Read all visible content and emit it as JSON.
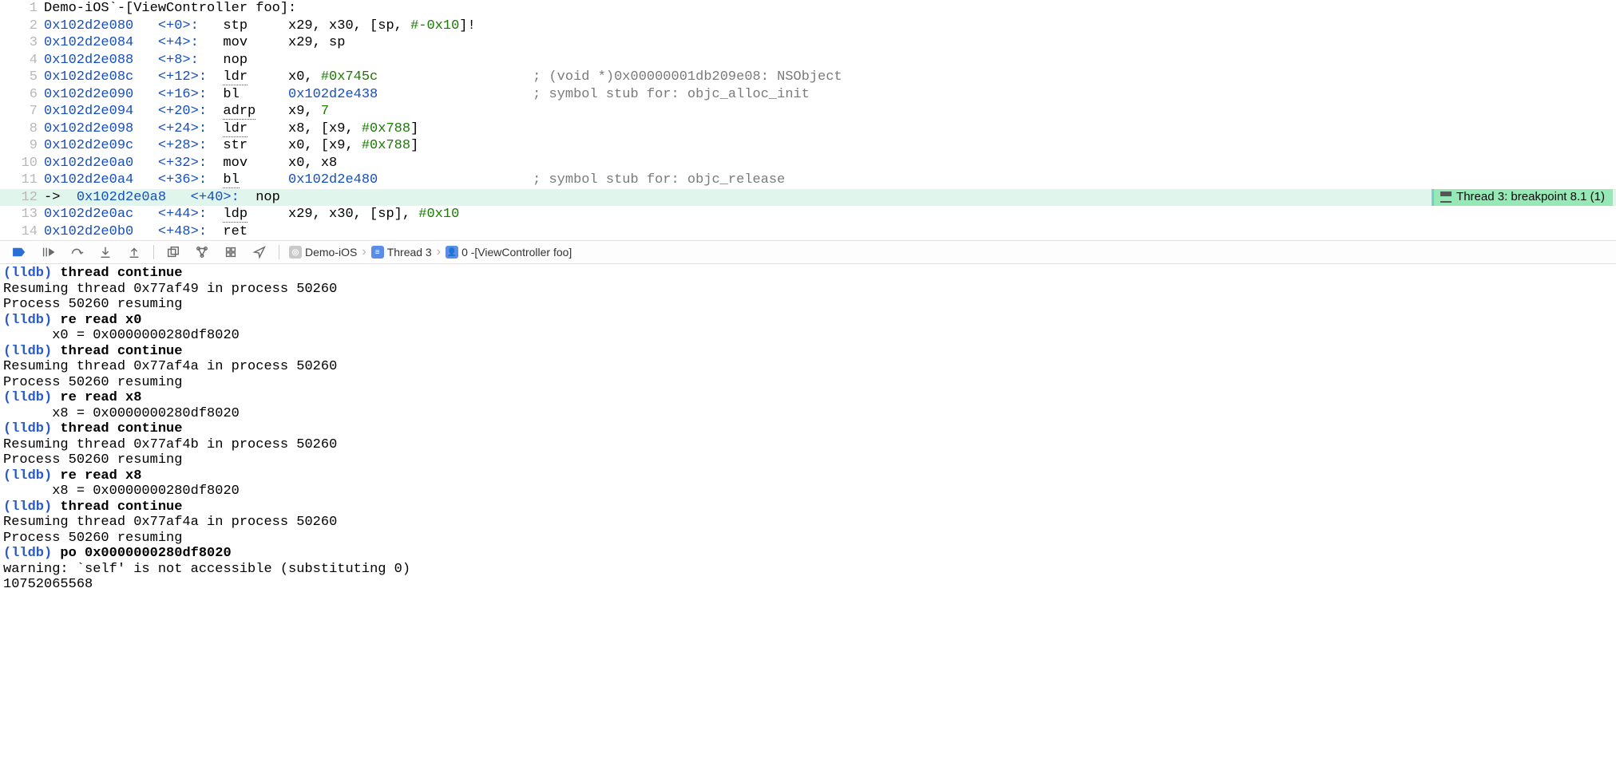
{
  "header_line": "Demo-iOS`-[ViewController foo]:",
  "lines": [
    {
      "ln": 1,
      "raw_header": true
    },
    {
      "ln": 2,
      "addr": "0x102d2e080",
      "off": "<+0>:",
      "mn": "stp",
      "ops": "x29, x30, [sp, ",
      "imm": "#-0x10",
      "ops2": "]!"
    },
    {
      "ln": 3,
      "addr": "0x102d2e084",
      "off": "<+4>:",
      "mn": "mov",
      "ops": "x29, sp"
    },
    {
      "ln": 4,
      "addr": "0x102d2e088",
      "off": "<+8>:",
      "mn": "nop"
    },
    {
      "ln": 5,
      "addr": "0x102d2e08c",
      "off": "<+12>:",
      "mn": "ldr",
      "dotted": true,
      "ops": "x0, ",
      "imm": "#0x745c",
      "cmt": "; (void *)0x00000001db209e08: NSObject"
    },
    {
      "ln": 6,
      "addr": "0x102d2e090",
      "off": "<+16>:",
      "mn": "bl",
      "sym": "0x102d2e438",
      "cmt": "; symbol stub for: objc_alloc_init"
    },
    {
      "ln": 7,
      "addr": "0x102d2e094",
      "off": "<+20>:",
      "mn": "adrp",
      "dotted": true,
      "ops": "x9, ",
      "imm": "7"
    },
    {
      "ln": 8,
      "addr": "0x102d2e098",
      "off": "<+24>:",
      "mn": "ldr",
      "dotted": true,
      "ops": "x8, [x9, ",
      "imm": "#0x788",
      "ops2": "]"
    },
    {
      "ln": 9,
      "addr": "0x102d2e09c",
      "off": "<+28>:",
      "mn": "str",
      "ops": "x0, [x9, ",
      "imm": "#0x788",
      "ops2": "]"
    },
    {
      "ln": 10,
      "addr": "0x102d2e0a0",
      "off": "<+32>:",
      "mn": "mov",
      "ops": "x0, x8"
    },
    {
      "ln": 11,
      "addr": "0x102d2e0a4",
      "off": "<+36>:",
      "mn": "bl",
      "dotted": true,
      "sym": "0x102d2e480",
      "cmt": "; symbol stub for: objc_release"
    },
    {
      "ln": 12,
      "addr": "0x102d2e0a8",
      "off": "<+40>:",
      "mn": "nop",
      "current": true,
      "arrow": "->"
    },
    {
      "ln": 13,
      "addr": "0x102d2e0ac",
      "off": "<+44>:",
      "mn": "ldp",
      "dotted": true,
      "ops": "x29, x30, [sp], ",
      "imm": "#0x10"
    },
    {
      "ln": 14,
      "addr": "0x102d2e0b0",
      "off": "<+48>:",
      "mn": "ret"
    }
  ],
  "breakpoint_badge": "Thread 3: breakpoint 8.1 (1)",
  "toolbar": {
    "crumbs": [
      {
        "icon": "target",
        "label": "Demo-iOS"
      },
      {
        "icon": "thread",
        "label": "Thread 3"
      },
      {
        "icon": "frame",
        "label": "0 -[ViewController foo]"
      }
    ]
  },
  "console": [
    {
      "p": "(lldb) ",
      "c": "thread continue"
    },
    {
      "o": "Resuming thread 0x77af49 in process 50260"
    },
    {
      "o": "Process 50260 resuming"
    },
    {
      "p": "(lldb) ",
      "c": "re read x0"
    },
    {
      "o": "      x0 = 0x0000000280df8020"
    },
    {
      "p": "(lldb) ",
      "c": "thread continue"
    },
    {
      "o": "Resuming thread 0x77af4a in process 50260"
    },
    {
      "o": "Process 50260 resuming"
    },
    {
      "p": "(lldb) ",
      "c": "re read x8"
    },
    {
      "o": "      x8 = 0x0000000280df8020"
    },
    {
      "p": "(lldb) ",
      "c": "thread continue"
    },
    {
      "o": "Resuming thread 0x77af4b in process 50260"
    },
    {
      "o": "Process 50260 resuming"
    },
    {
      "p": "(lldb) ",
      "c": "re read x8"
    },
    {
      "o": "      x8 = 0x0000000280df8020"
    },
    {
      "p": "(lldb) ",
      "c": "thread continue"
    },
    {
      "o": "Resuming thread 0x77af4a in process 50260"
    },
    {
      "o": "Process 50260 resuming"
    },
    {
      "p": "(lldb) ",
      "c": "po 0x0000000280df8020"
    },
    {
      "o": "warning: `self' is not accessible (substituting 0)"
    },
    {
      "o": "10752065568"
    }
  ]
}
